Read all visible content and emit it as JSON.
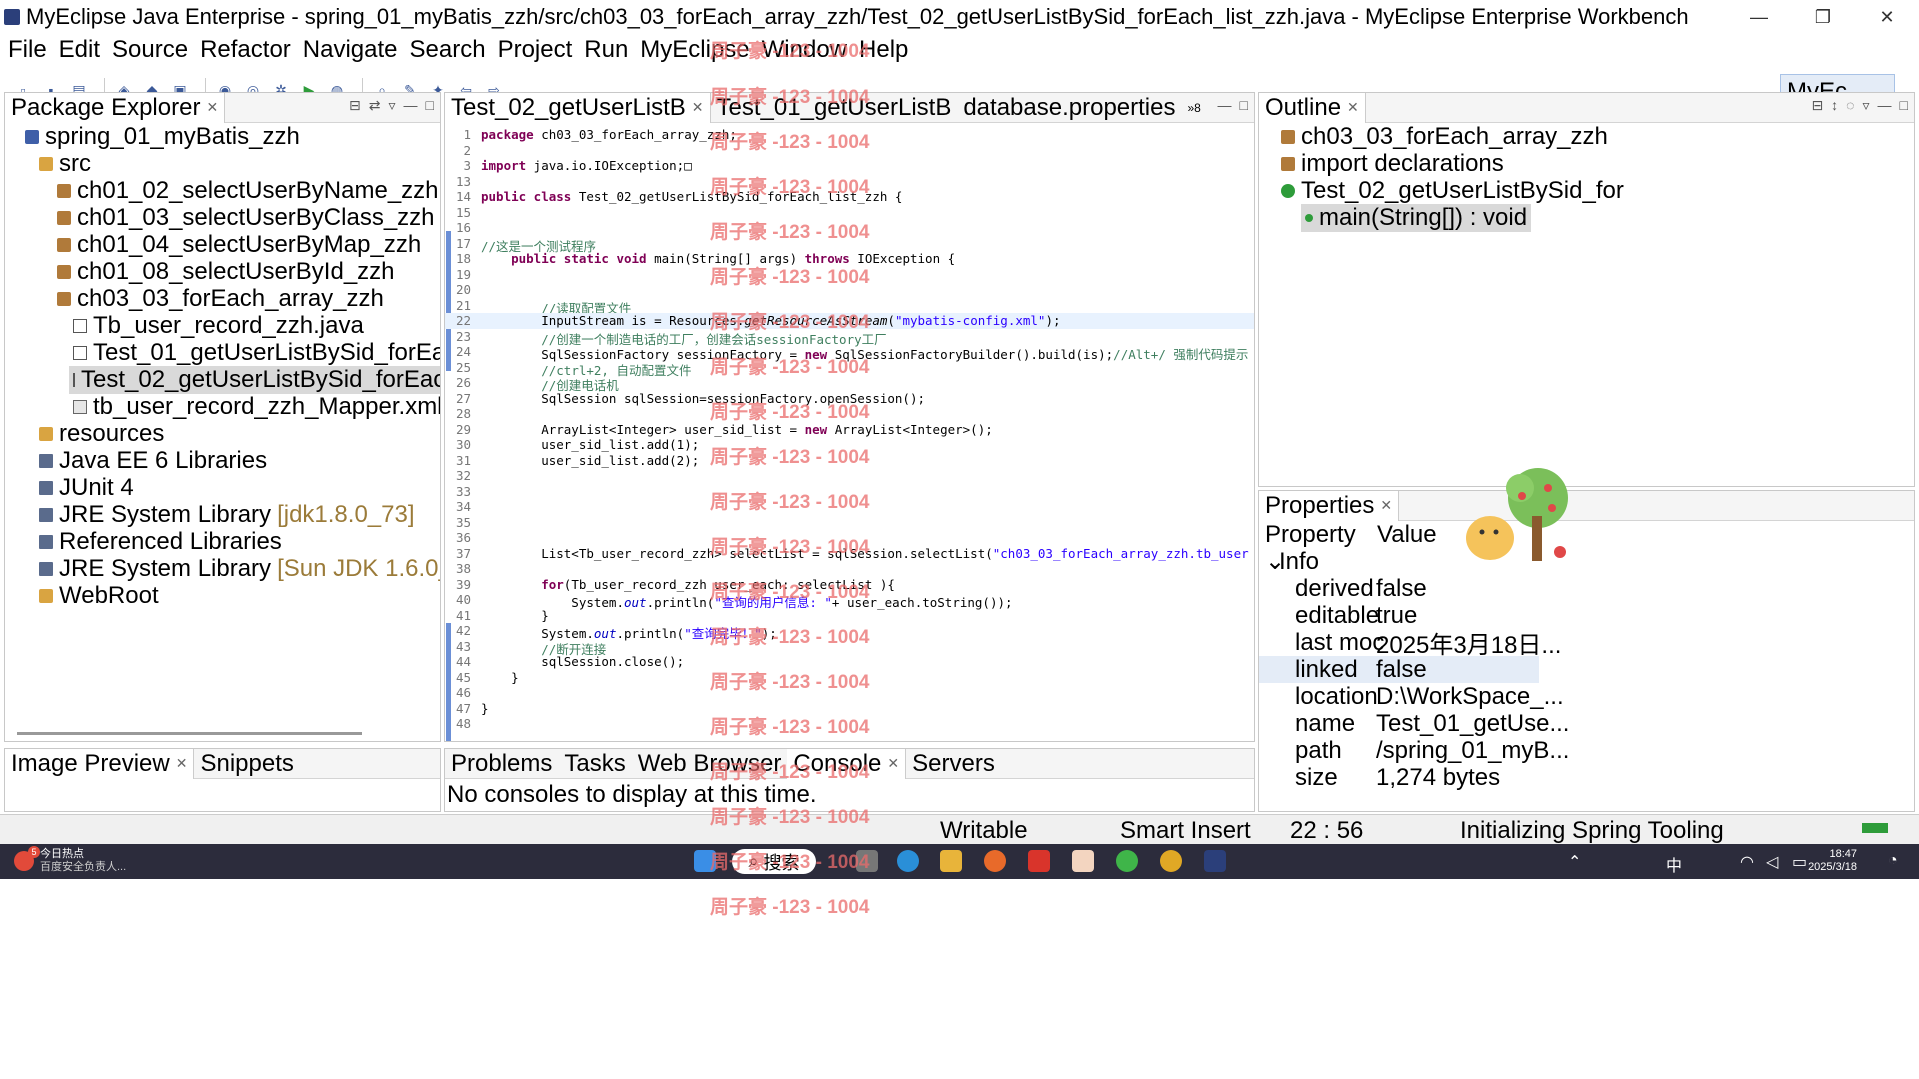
{
  "window": {
    "title": "MyEclipse Java Enterprise - spring_01_myBatis_zzh/src/ch03_03_forEach_array_zzh/Test_02_getUserListBySid_forEach_list_zzh.java - MyEclipse Enterprise Workbench",
    "minimize": "—",
    "maximize": "❐",
    "close": "✕"
  },
  "menu": [
    "File",
    "Edit",
    "Source",
    "Refactor",
    "Navigate",
    "Search",
    "Project",
    "Run",
    "MyEclipse",
    "Window",
    "Help"
  ],
  "perspective": "MyEc...",
  "package_explorer": {
    "title": "Package Explorer",
    "items": [
      {
        "label": "spring_01_myBatis_zzh",
        "icon": "project-icon"
      },
      {
        "label": "src",
        "icon": "source-folder-icon"
      },
      {
        "label": "ch01_02_selectUserByName_zzh",
        "icon": "package-icon"
      },
      {
        "label": "ch01_03_selectUserByClass_zzh",
        "icon": "package-icon"
      },
      {
        "label": "ch01_04_selectUserByMap_zzh",
        "icon": "package-icon"
      },
      {
        "label": "ch01_08_selectUserById_zzh",
        "icon": "package-icon"
      },
      {
        "label": "ch03_03_forEach_array_zzh",
        "icon": "package-icon"
      },
      {
        "label": "Tb_user_record_zzh.java",
        "icon": "java-file-icon"
      },
      {
        "label": "Test_01_getUserListBySid_forEach_array",
        "icon": "java-file-icon"
      },
      {
        "label": "Test_02_getUserListBySid_forEach_list_z",
        "icon": "java-file-icon"
      },
      {
        "label": "tb_user_record_zzh_Mapper.xml",
        "icon": "xml-file-icon"
      },
      {
        "label": "resources",
        "icon": "folder-icon"
      },
      {
        "label": "Java EE 6 Libraries",
        "icon": "library-icon"
      },
      {
        "label": "JUnit 4",
        "icon": "library-icon"
      },
      {
        "label": "JRE System Library",
        "hint": "[jdk1.8.0_73]",
        "icon": "library-icon"
      },
      {
        "label": "Referenced Libraries",
        "icon": "library-icon"
      },
      {
        "label": "JRE System Library",
        "hint": "[Sun JDK 1.6.0_13]",
        "icon": "library-icon"
      },
      {
        "label": "WebRoot",
        "icon": "folder-icon"
      }
    ]
  },
  "editor": {
    "tabs": [
      {
        "label": "Test_02_getUserListB",
        "active": true
      },
      {
        "label": "Test_01_getUserListB",
        "active": false
      },
      {
        "label": "database.properties",
        "active": false
      }
    ],
    "overflow_count": "8",
    "lines": [
      {
        "n": "1",
        "html": "<span class='kw'>package</span> ch03_03_forEach_array_zzh;"
      },
      {
        "n": "2",
        "html": ""
      },
      {
        "n": "3",
        "html": "<span class='kw'>import</span> java.io.IOException;&#9633;"
      },
      {
        "n": "13",
        "html": ""
      },
      {
        "n": "14",
        "html": "<span class='kw'>public class</span> Test_02_getUserListBySid_forEach_list_zzh {"
      },
      {
        "n": "15",
        "html": ""
      },
      {
        "n": "16",
        "html": ""
      },
      {
        "n": "17",
        "html": "<span class='cmt'>//这是一个测试程序</span>"
      },
      {
        "n": "18",
        "html": "    <span class='kw'>public static void</span> main(String[] args) <span class='kw'>throws</span> IOException {"
      },
      {
        "n": "19",
        "html": ""
      },
      {
        "n": "20",
        "html": ""
      },
      {
        "n": "21",
        "html": "        <span class='cmt'>//读取配置文件</span>"
      },
      {
        "n": "22",
        "html": "        InputStream is = Resources.<i>getResourceAsStream</i>(<span class='str'>\"mybatis-config.xml\"</span>);"
      },
      {
        "n": "23",
        "html": "        <span class='cmt'>//创建一个制造电话的工厂，创建会话sessionFactory工厂</span>"
      },
      {
        "n": "24",
        "html": "        SqlSessionFactory sessionFactory = <span class='kw'>new</span> SqlSessionFactoryBuilder().build(is);<span class='cmt'>//Alt+/ 强制代码提示</span>"
      },
      {
        "n": "25",
        "html": "        <span class='cmt'>//ctrl+2, 自动配置文件</span>"
      },
      {
        "n": "26",
        "html": "        <span class='cmt'>//创建电话机</span>"
      },
      {
        "n": "27",
        "html": "        SqlSession sqlSession=sessionFactory.openSession();"
      },
      {
        "n": "28",
        "html": ""
      },
      {
        "n": "29",
        "html": "        ArrayList&lt;Integer&gt; user_sid_list = <span class='kw'>new</span> ArrayList&lt;Integer&gt;();"
      },
      {
        "n": "30",
        "html": "        user_sid_list.add(1);"
      },
      {
        "n": "31",
        "html": "        user_sid_list.add(2);"
      },
      {
        "n": "32",
        "html": ""
      },
      {
        "n": "33",
        "html": ""
      },
      {
        "n": "34",
        "html": ""
      },
      {
        "n": "35",
        "html": ""
      },
      {
        "n": "36",
        "html": ""
      },
      {
        "n": "37",
        "html": "        List&lt;Tb_user_record_zzh&gt; selectList = sqlSession.selectList(<span class='str'>\"ch03_03_forEach_array_zzh.tb_user</span>"
      },
      {
        "n": "38",
        "html": ""
      },
      {
        "n": "39",
        "html": "        <span class='kw'>for</span>(Tb_user_record_zzh user_each: selectList ){"
      },
      {
        "n": "40",
        "html": "            System.<span class='fld'>out</span>.println(<span class='str'>\"查询的用户信息: \"</span>+ user_each.toString());"
      },
      {
        "n": "41",
        "html": "        }"
      },
      {
        "n": "42",
        "html": "        System.<span class='fld'>out</span>.println(<span class='str'>\"查询完毕！\"</span>);"
      },
      {
        "n": "43",
        "html": "        <span class='cmt'>//断开连接</span>"
      },
      {
        "n": "44",
        "html": "        sqlSession.close();"
      },
      {
        "n": "45",
        "html": "    }"
      },
      {
        "n": "46",
        "html": ""
      },
      {
        "n": "47",
        "html": "}"
      },
      {
        "n": "48",
        "html": ""
      }
    ]
  },
  "watermark": "周子豪 -123 - 1004",
  "outline": {
    "title": "Outline",
    "items": [
      {
        "label": "ch03_03_forEach_array_zzh"
      },
      {
        "label": "import declarations"
      },
      {
        "label": "Test_02_getUserListBySid_for"
      },
      {
        "label": "main(String[]) : void"
      }
    ]
  },
  "properties": {
    "title": "Properties",
    "col_property": "Property",
    "col_value": "Value",
    "group": "Info",
    "rows": [
      {
        "key": "derived",
        "value": "false"
      },
      {
        "key": "editable",
        "value": "true"
      },
      {
        "key": "last moc",
        "value": "2025年3月18日..."
      },
      {
        "key": "linked",
        "value": "false"
      },
      {
        "key": "location",
        "value": "D:\\WorkSpace_..."
      },
      {
        "key": "name",
        "value": "Test_01_getUse..."
      },
      {
        "key": "path",
        "value": "/spring_01_myB..."
      },
      {
        "key": "size",
        "value": "1,274  bytes"
      }
    ]
  },
  "bottom_left": {
    "tabs": [
      "Image Preview",
      "Snippets"
    ]
  },
  "bottom_center": {
    "tabs": [
      "Problems",
      "Tasks",
      "Web Browser",
      "Console",
      "Servers"
    ],
    "active": "Console",
    "message": "No consoles to display at this time."
  },
  "status": {
    "writable": "Writable",
    "insert_mode": "Smart Insert",
    "position": "22 : 56",
    "task": "Initializing Spring Tooling"
  },
  "taskbar": {
    "news_title": "今日热点",
    "news_sub": "百度安全负责人...",
    "news_badge": "5",
    "search": "搜索",
    "ime": "中",
    "time": "18:47",
    "date": "2025/3/18"
  }
}
